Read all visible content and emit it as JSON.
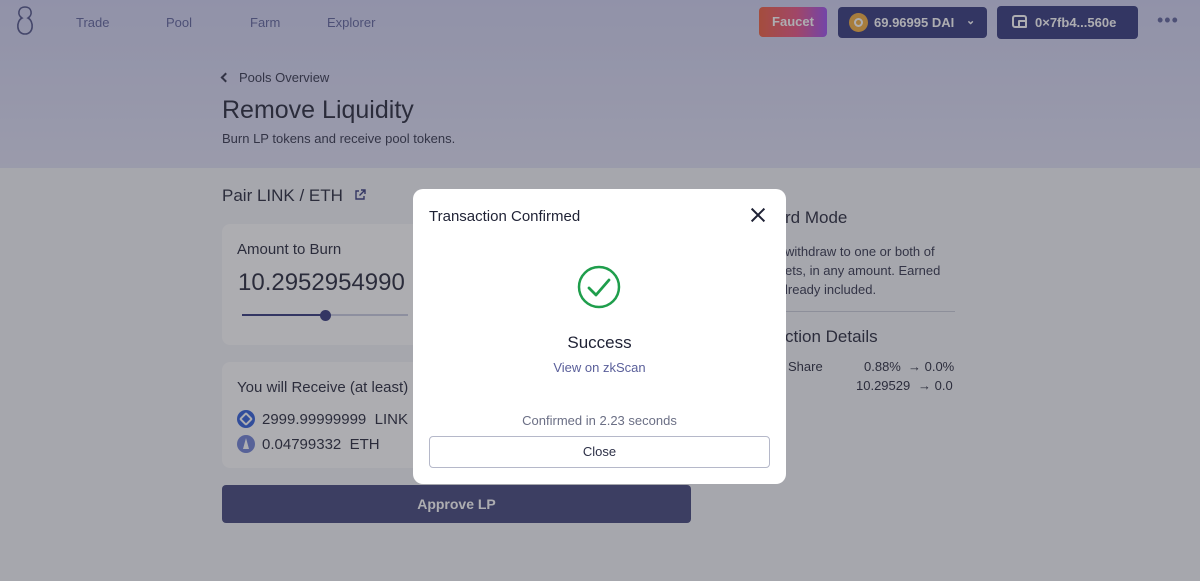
{
  "nav": {
    "links": [
      "Trade",
      "Pool",
      "Farm",
      "Explorer"
    ],
    "faucet_label": "Faucet",
    "balance": "69.96995 DAI",
    "wallet_address": "0×7fb4...560e",
    "more_icon": "more-dots-icon",
    "logo_icon": "logo-icon"
  },
  "header": {
    "back_label": "Pools Overview",
    "title": "Remove Liquidity",
    "subtitle": "Burn LP tokens and receive pool tokens."
  },
  "pair": {
    "title": "Pair LINK / ETH",
    "link_icon": "external-link-icon"
  },
  "burn": {
    "label": "Amount to Burn",
    "amount": "10.2952954990",
    "slider_fraction": 0.5
  },
  "receive": {
    "label": "You will Receive (at least)",
    "tokens": [
      {
        "amount": "2999.99999999",
        "symbol": "LINK",
        "icon": "link-token-icon"
      },
      {
        "amount": "0.04799332",
        "symbol": "ETH",
        "icon": "eth-token-icon"
      }
    ]
  },
  "approve_label": "Approve LP",
  "side": {
    "mode_title": "rd Mode",
    "mode_text": [
      "withdraw to one or both of",
      "ets, in any amount. Earned",
      "lready included."
    ],
    "details_title": "ction Details",
    "share_label": "Share",
    "share_old": "0.88%",
    "share_new": "→ 0.0%",
    "lp_old": "10.29529",
    "lp_new": "→ 0.0"
  },
  "modal": {
    "title": "Transaction Confirmed",
    "status": "Success",
    "explorer_link": "View on zkScan",
    "confirmed_text": "Confirmed in 2.23 seconds",
    "close_label": "Close",
    "status_icon": "check-circle-icon"
  },
  "colors": {
    "primary": "#2e3279",
    "accent_text": "#5a5f9a",
    "success_green": "#1f9e4c"
  }
}
